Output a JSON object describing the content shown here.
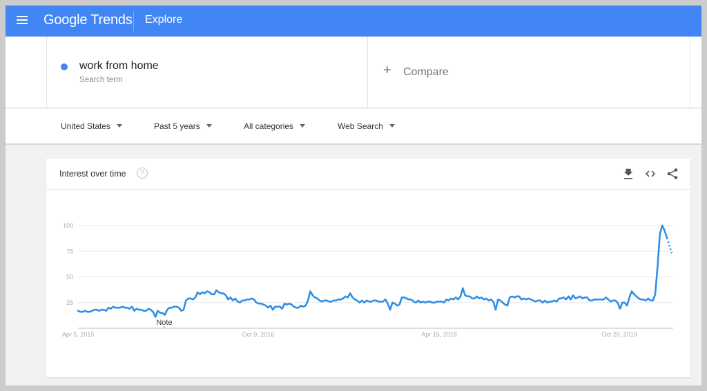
{
  "topbar": {
    "app_name": "Google Trends",
    "section": "Explore",
    "menu_icon": "menu-icon",
    "color": "#4285f4"
  },
  "search_terms": [
    {
      "label": "work from home",
      "type": "Search term",
      "color": "#4285f4"
    }
  ],
  "compare": {
    "label": "Compare",
    "icon": "plus-icon"
  },
  "filters": [
    {
      "label": "United States"
    },
    {
      "label": "Past 5 years"
    },
    {
      "label": "All categories"
    },
    {
      "label": "Web Search"
    }
  ],
  "card": {
    "title": "Interest over time",
    "help_icon": "help-icon",
    "actions": [
      "download-icon",
      "embed-icon",
      "share-icon"
    ]
  },
  "chart_data": {
    "type": "line",
    "title": "Interest over time",
    "xlabel": "",
    "ylabel": "",
    "ylim": [
      0,
      100
    ],
    "yticks": [
      25,
      50,
      75,
      100
    ],
    "xtick_labels": [
      "Apr 5, 2015",
      "Oct 9, 2016",
      "Apr 15, 2018",
      "Oct 20, 2019"
    ],
    "x_start": "Apr 5, 2015",
    "x_end": "Mar 2020",
    "grid": true,
    "legend": "none",
    "annotations": [
      {
        "label": "Note",
        "at_fraction": 0.145
      }
    ],
    "series": [
      {
        "name": "work from home",
        "color": "#2e8fe5",
        "resolution": "approx. bi-weekly samples of weekly data",
        "values": [
          17,
          16,
          16,
          17,
          16,
          16,
          17,
          18,
          18,
          17,
          18,
          18,
          17,
          20,
          19,
          21,
          20,
          20,
          20,
          21,
          20,
          20,
          19,
          21,
          17,
          19,
          18,
          18,
          17,
          17,
          19,
          18,
          16,
          11,
          17,
          15,
          15,
          13,
          18,
          20,
          20,
          21,
          21,
          20,
          17,
          18,
          27,
          29,
          29,
          28,
          30,
          35,
          33,
          35,
          34,
          36,
          35,
          33,
          33,
          37,
          35,
          34,
          34,
          32,
          28,
          30,
          27,
          29,
          26,
          25,
          27,
          27,
          28,
          28,
          29,
          28,
          25,
          24,
          24,
          23,
          22,
          20,
          22,
          18,
          21,
          21,
          21,
          19,
          24,
          23,
          24,
          23,
          21,
          20,
          20,
          22,
          21,
          22,
          27,
          36,
          32,
          30,
          29,
          27,
          26,
          27,
          27,
          26,
          26,
          27,
          27,
          28,
          28,
          29,
          31,
          30,
          34,
          30,
          28,
          27,
          25,
          27,
          25,
          27,
          26,
          26,
          27,
          27,
          26,
          26,
          26,
          28,
          24,
          18,
          25,
          24,
          22,
          23,
          30,
          30,
          29,
          28,
          28,
          26,
          25,
          27,
          25,
          26,
          25,
          26,
          26,
          25,
          25,
          26,
          26,
          26,
          25,
          28,
          27,
          29,
          28,
          30,
          28,
          31,
          39,
          32,
          31,
          31,
          29,
          29,
          31,
          29,
          30,
          28,
          29,
          27,
          28,
          26,
          18,
          28,
          27,
          25,
          23,
          22,
          30,
          31,
          30,
          31,
          31,
          28,
          29,
          28,
          29,
          28,
          27,
          26,
          27,
          27,
          25,
          27,
          25,
          26,
          26,
          27,
          26,
          29,
          29,
          30,
          28,
          31,
          28,
          32,
          29,
          30,
          31,
          29,
          30,
          30,
          27,
          27,
          28,
          28,
          28,
          28,
          28,
          30,
          28,
          26,
          27,
          27,
          25,
          19,
          25,
          25,
          22,
          30,
          36,
          33,
          31,
          29,
          28,
          28,
          27,
          29,
          27,
          27,
          33,
          60,
          92,
          100,
          95,
          88
        ],
        "partial_values": [
          88,
          73
        ]
      }
    ]
  }
}
